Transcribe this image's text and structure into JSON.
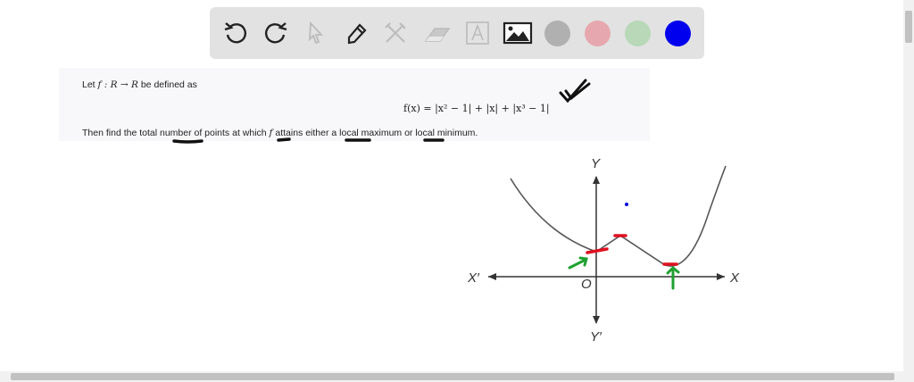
{
  "toolbar": {
    "tools": [
      "undo-icon",
      "redo-icon",
      "select-icon",
      "pen-icon",
      "tools-icon",
      "eraser-icon",
      "text-icon",
      "image-icon"
    ],
    "colors": [
      "#b0b0b0",
      "#e6a8ae",
      "#b8d8b8",
      "#0000ee"
    ]
  },
  "problem": {
    "line1_prefix": "Let",
    "line1_math": "f : R → R",
    "line1_suffix": "be defined as",
    "formula": "f(x) = |x² − 1| + |x| + |x³ − 1|",
    "line2_a": "Then find the total number of points at which",
    "line2_f": "f",
    "line2_b": "attains either a local maximum or local minimum."
  },
  "graph": {
    "x_label": "X",
    "x_neg_label": "X′",
    "y_label": "Y",
    "y_neg_label": "Y′",
    "origin_label": "O"
  }
}
